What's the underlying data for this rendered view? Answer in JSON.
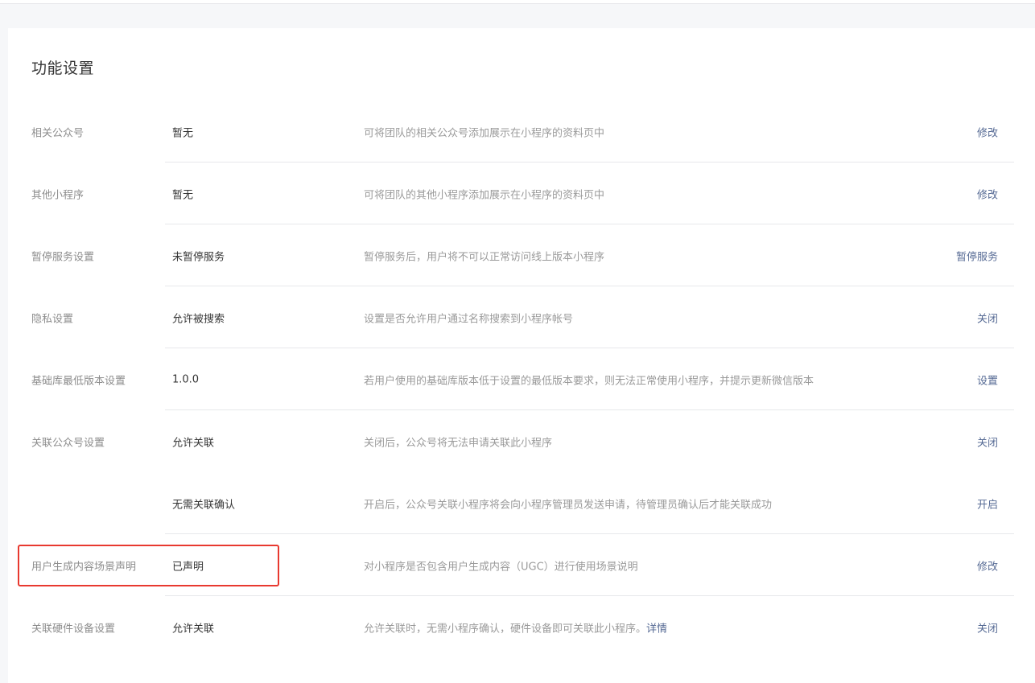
{
  "section": {
    "title": "功能设置"
  },
  "rows": [
    {
      "label": "相关公众号",
      "value": "暂无",
      "desc": "可将团队的相关公众号添加展示在小程序的资料页中",
      "action": "修改"
    },
    {
      "label": "其他小程序",
      "value": "暂无",
      "desc": "可将团队的其他小程序添加展示在小程序的资料页中",
      "action": "修改"
    },
    {
      "label": "暂停服务设置",
      "value": "未暂停服务",
      "desc": "暂停服务后，用户将不可以正常访问线上版本小程序",
      "action": "暂停服务"
    },
    {
      "label": "隐私设置",
      "value": "允许被搜索",
      "desc": "设置是否允许用户通过名称搜索到小程序帐号",
      "action": "关闭"
    },
    {
      "label": "基础库最低版本设置",
      "value": "1.0.0",
      "desc": "若用户使用的基础库版本低于设置的最低版本要求，则无法正常使用小程序，并提示更新微信版本",
      "action": "设置"
    },
    {
      "label": "关联公众号设置",
      "value": "允许关联",
      "desc": "关闭后，公众号将无法申请关联此小程序",
      "action": "关闭"
    },
    {
      "label": "",
      "value": "无需关联确认",
      "desc": "开启后，公众号关联小程序将会向小程序管理员发送申请，待管理员确认后才能关联成功",
      "action": "开启"
    },
    {
      "label": "用户生成内容场景声明",
      "value": "已声明",
      "desc": "对小程序是否包含用户生成内容（UGC）进行使用场景说明",
      "action": "修改"
    },
    {
      "label": "关联硬件设备设置",
      "value": "允许关联",
      "desc": "允许关联时，无需小程序确认，硬件设备即可关联此小程序。",
      "desc_link": "详情",
      "action": "关闭"
    }
  ],
  "colors": {
    "link": "#576b95",
    "highlight": "#e8392f"
  }
}
